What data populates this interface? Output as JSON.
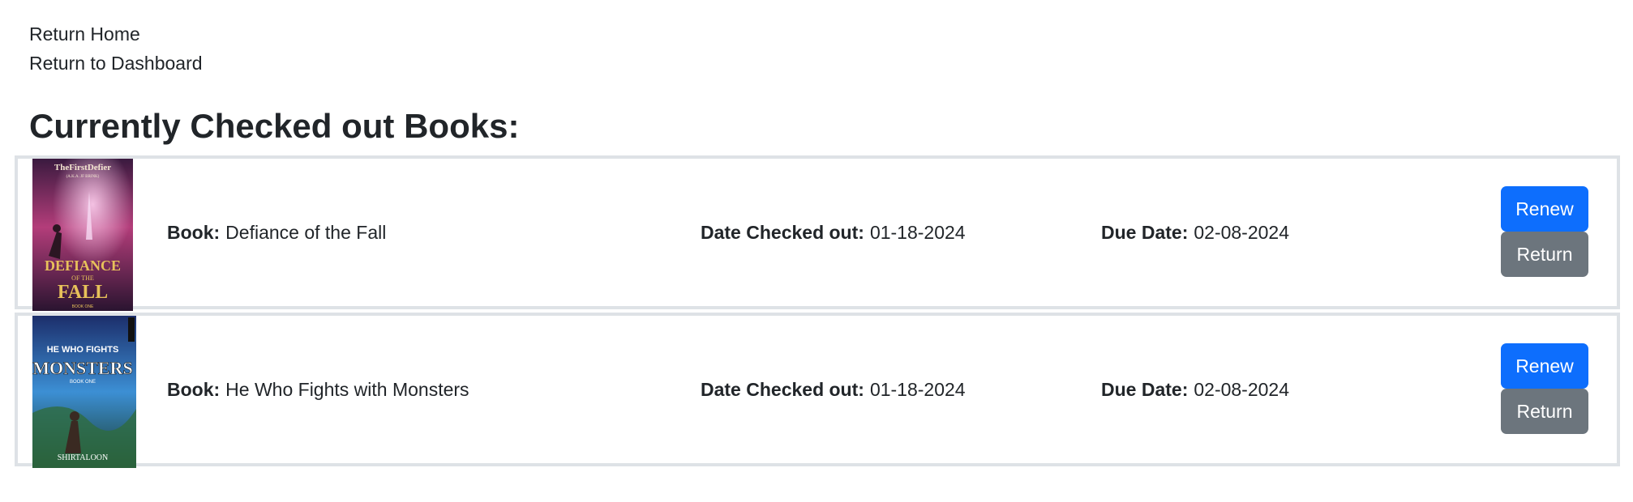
{
  "nav": {
    "return_home": "Return Home",
    "return_dashboard": "Return to Dashboard"
  },
  "page_title": "Currently Checked out Books:",
  "labels": {
    "book": "Book:",
    "date_checked_out": "Date Checked out:",
    "due_date": "Due Date:"
  },
  "books": [
    {
      "title": "Defiance of the Fall",
      "checked_out": "01-18-2024",
      "due": "02-08-2024",
      "renew_label": "Renew",
      "return_label": "Return",
      "cover": {
        "author": "TheFirstDefier",
        "subtitle": "(A.K.A. JF BRINK)",
        "title_line1": "DEFIANCE",
        "title_line2": "OF THE",
        "title_line3": "FALL",
        "footer": "BOOK ONE",
        "colors": {
          "top": "#3a1a3f",
          "mid": "#b33d7a",
          "bottom": "#2a1430",
          "title": "#e7c15a"
        }
      }
    },
    {
      "title": "He Who Fights with Monsters",
      "checked_out": "01-18-2024",
      "due": "02-08-2024",
      "renew_label": "Renew",
      "return_label": "Return",
      "cover": {
        "title_line1": "HE WHO FIGHTS",
        "title_line2": "MONSTERS",
        "title_line3": "BOOK ONE",
        "author": "SHIRTALOON",
        "colors": {
          "top": "#1c2e6b",
          "mid": "#3c8fd4",
          "bottom": "#1a3b2a",
          "title": "#ffffff"
        }
      }
    }
  ]
}
